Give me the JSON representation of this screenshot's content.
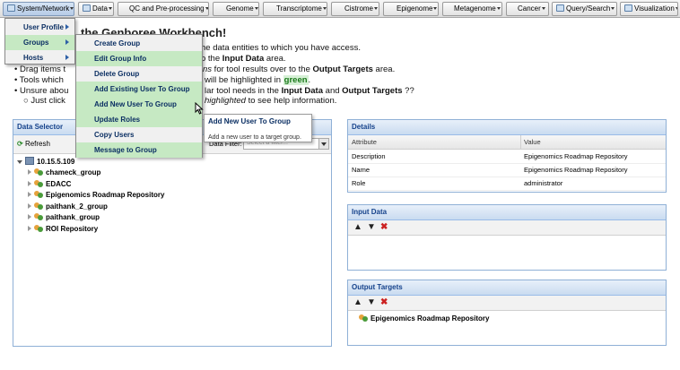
{
  "menubar": {
    "items": [
      {
        "label": "System/Network"
      },
      {
        "label": "Data"
      },
      {
        "label": "QC and Pre-processing"
      },
      {
        "label": "Genome"
      },
      {
        "label": "Transcriptome"
      },
      {
        "label": "Cistrome"
      },
      {
        "label": "Epigenome"
      },
      {
        "label": "Metagenome"
      },
      {
        "label": "Cancer"
      },
      {
        "label": "Query/Search"
      },
      {
        "label": "Visualization"
      }
    ]
  },
  "intro": {
    "title_fragment": "the Genboree Workbench!",
    "line1_fragment": "he data entities to which you have access.",
    "line2_fragment_pre": "o the ",
    "line2_bold": "Input Data",
    "line2_post": " area.",
    "line3_pre": "Drag items t",
    "line3_italic": "ns",
    "line3_mid": " for tool results over to the ",
    "line3_bold": "Output Targets",
    "line3_post": " area.",
    "line4_pre": "Tools which",
    "line4_mid": "will be highlighted in ",
    "line4_green": "green",
    "line4_post": ".",
    "line5_pre": "Unsure abou",
    "line5_mid": "lar tool needs in the ",
    "line5_bold1": "Input Data",
    "line5_and": " and ",
    "line5_bold2": "Output Targets",
    "line5_post": " ??",
    "line6_pre": "Just click",
    "line6_italic": "highlighted",
    "line6_post": " to see help information."
  },
  "system_menu": {
    "items": [
      {
        "label": "User Profile"
      },
      {
        "label": "Groups"
      },
      {
        "label": "Hosts"
      }
    ]
  },
  "groups_menu": {
    "items": [
      {
        "label": "Create Group"
      },
      {
        "label": "Edit Group Info"
      },
      {
        "label": "Delete Group"
      },
      {
        "label": "Add Existing User To Group"
      },
      {
        "label": "Add New User To Group"
      },
      {
        "label": "Update Roles"
      },
      {
        "label": "Copy Users"
      },
      {
        "label": "Message to Group"
      }
    ]
  },
  "tooltip": {
    "title": "Add New User To Group",
    "body": "Add a new user to a target group."
  },
  "data_selector": {
    "title": "Data Selector",
    "refresh_label": "Refresh",
    "filter_label": "Data Filter:",
    "filter_placeholder": "Select a filter...",
    "root": "10.15.5.109",
    "groups": [
      {
        "label": "chameck_group"
      },
      {
        "label": "EDACC"
      },
      {
        "label": "Epigenomics Roadmap Repository"
      },
      {
        "label": "paithank_2_group"
      },
      {
        "label": "paithank_group"
      },
      {
        "label": "ROI Repository"
      }
    ]
  },
  "details": {
    "title": "Details",
    "col_attribute": "Attribute",
    "col_value": "Value",
    "rows": [
      {
        "attribute": "Description",
        "value": "Epigenomics Roadmap Repository"
      },
      {
        "attribute": "Name",
        "value": "Epigenomics Roadmap Repository"
      },
      {
        "attribute": "Role",
        "value": "administrator"
      }
    ]
  },
  "input_data": {
    "title": "Input Data"
  },
  "output_targets": {
    "title": "Output Targets",
    "items": [
      {
        "label": "Epigenomics Roadmap Repository"
      }
    ]
  },
  "icons": {
    "move_up": "▲",
    "move_down": "▼",
    "remove": "✖"
  },
  "colors": {
    "highlight_green": "#c6e9c3",
    "panel_header_text": "#15428b",
    "remove_red": "#cc2222"
  }
}
